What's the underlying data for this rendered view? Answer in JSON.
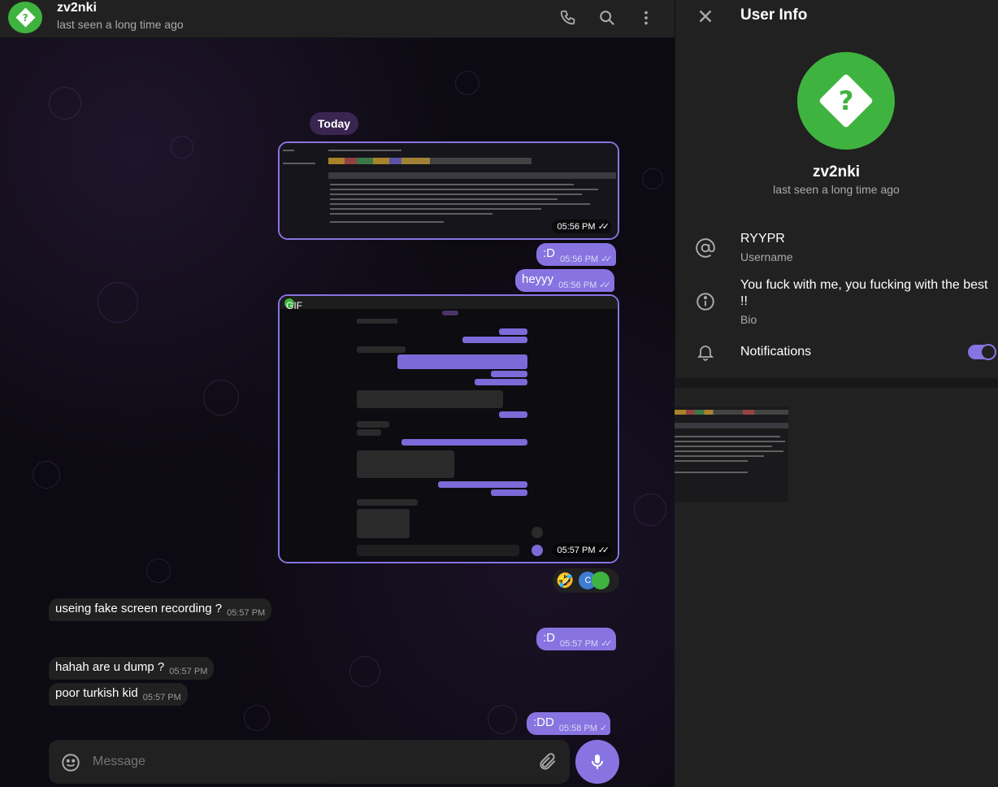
{
  "header": {
    "peer_name": "zv2nki",
    "peer_status": "last seen a long time ago",
    "avatar_glyph": "?"
  },
  "chat": {
    "date_label": "Today",
    "messages": [
      {
        "dir": "out",
        "type": "image",
        "time": "05:56 PM",
        "status": "read"
      },
      {
        "dir": "out",
        "text": ":D",
        "time": "05:56 PM",
        "status": "read"
      },
      {
        "dir": "out",
        "text": "heyyy",
        "time": "05:56 PM",
        "status": "read"
      },
      {
        "dir": "out",
        "type": "gif",
        "gif_label": "GIF",
        "time": "05:57 PM",
        "status": "read"
      },
      {
        "dir": "in",
        "text": "useing fake screen recording ?",
        "time": "05:57 PM"
      },
      {
        "dir": "out",
        "text": ":D",
        "time": "05:57 PM",
        "status": "read"
      },
      {
        "dir": "in",
        "text": "hahah are u dump ?",
        "time": "05:57 PM"
      },
      {
        "dir": "in",
        "text": "poor turkish kid",
        "time": "05:57 PM"
      },
      {
        "dir": "out",
        "text": ":DD",
        "time": "05:58 PM",
        "status": "sent"
      }
    ],
    "reaction": {
      "emoji": "🤣",
      "avatar_letter": "C"
    }
  },
  "composer": {
    "placeholder": "Message"
  },
  "sidebar": {
    "title": "User Info",
    "name": "zv2nki",
    "status": "last seen a long time ago",
    "username_value": "RYYPR",
    "username_label": "Username",
    "bio_value": "You fuck with me, you fucking with the best !!",
    "bio_label": "Bio",
    "notifications_label": "Notifications",
    "notifications_on": true
  },
  "colors": {
    "accent": "#8774e1",
    "avatar": "#3fb33f",
    "panel": "#212121"
  }
}
